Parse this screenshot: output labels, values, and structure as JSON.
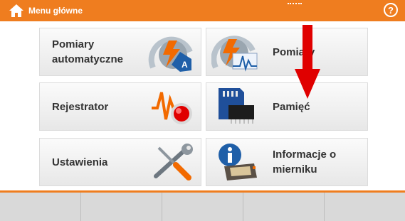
{
  "header": {
    "title": "Menu główne",
    "help_label": "?",
    "accent_color": "#ef7d1f"
  },
  "tiles": [
    {
      "label_line1": "Pomiary",
      "label_line2": "automatyczne",
      "icon": "auto-measurement-icon"
    },
    {
      "label_line1": "Pomiary",
      "label_line2": "",
      "icon": "measurement-waveform-icon"
    },
    {
      "label_line1": "Rejestrator",
      "label_line2": "",
      "icon": "recorder-icon"
    },
    {
      "label_line1": "Pamięć",
      "label_line2": "",
      "icon": "memory-card-icon"
    },
    {
      "label_line1": "Ustawienia",
      "label_line2": "",
      "icon": "settings-tools-icon"
    },
    {
      "label_line1": "Informacje o",
      "label_line2": "mierniku",
      "icon": "info-meter-icon"
    }
  ],
  "annotation": {
    "color": "#e00000"
  },
  "function_keys": [
    "",
    "",
    "",
    "",
    ""
  ]
}
